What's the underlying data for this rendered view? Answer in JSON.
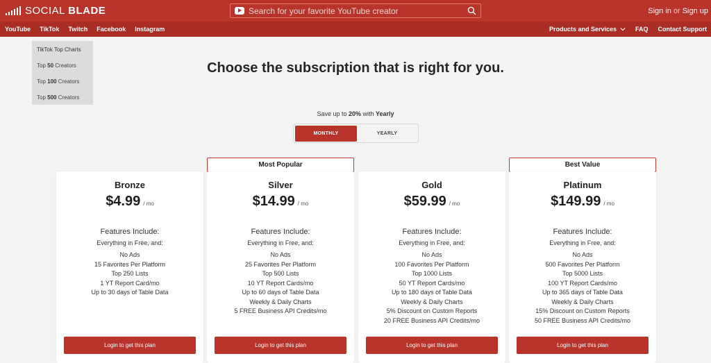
{
  "brand": {
    "name_light": "SOCIAL ",
    "name_bold": "BLADE"
  },
  "search": {
    "placeholder": "Search for your favorite YouTube creator"
  },
  "auth": {
    "sign_in": "Sign in",
    "or": "or",
    "sign_up": "Sign up"
  },
  "nav": {
    "left": [
      "YouTube",
      "TikTok",
      "Twitch",
      "Facebook",
      "Instagram"
    ],
    "products": "Products and Services",
    "faq": "FAQ",
    "contact": "Contact Support"
  },
  "dropdown": {
    "title": "TikTok Top Charts",
    "items": [
      {
        "pre": "Top ",
        "num": "50",
        "post": " Creators"
      },
      {
        "pre": "Top ",
        "num": "100",
        "post": " Creators"
      },
      {
        "pre": "Top ",
        "num": "500",
        "post": " Creators"
      }
    ]
  },
  "headline": "Choose the subscription that is right for you.",
  "save_note": {
    "pre": "Save up to ",
    "pct": "20%",
    "mid": " with ",
    "period": "Yearly"
  },
  "toggle": {
    "monthly": "MONTHLY",
    "yearly": "YEARLY",
    "selected": "MONTHLY"
  },
  "ribbons": {
    "silver": "Most Popular",
    "platinum": "Best Value"
  },
  "plans": [
    {
      "name": "Bronze",
      "price": "$4.99",
      "per": "/ mo",
      "features_head": "Features Include:",
      "features_sub": "Everything in Free, and:",
      "features": [
        "No Ads",
        "15 Favorites Per Platform",
        "Top 250 Lists",
        "1 YT Report Card/mo",
        "Up to 30 days of Table Data"
      ],
      "cta": "Login to get this plan"
    },
    {
      "name": "Silver",
      "price": "$14.99",
      "per": "/ mo",
      "features_head": "Features Include:",
      "features_sub": "Everything in Free, and:",
      "features": [
        "No Ads",
        "25 Favorites Per Platform",
        "Top 500 Lists",
        "10 YT Report Cards/mo",
        "Up to 60 days of Table Data",
        "Weekly & Daily Charts",
        "5 FREE Business API Credits/mo"
      ],
      "cta": "Login to get this plan"
    },
    {
      "name": "Gold",
      "price": "$59.99",
      "per": "/ mo",
      "features_head": "Features Include:",
      "features_sub": "Everything in Free, and:",
      "features": [
        "No Ads",
        "100 Favorites Per Platform",
        "Top 1000 Lists",
        "50 YT Report Cards/mo",
        "Up to 180 days of Table Data",
        "Weekly & Daily Charts",
        "5% Discount on Custom Reports",
        "20 FREE Business API Credits/mo"
      ],
      "cta": "Login to get this plan"
    },
    {
      "name": "Platinum",
      "price": "$149.99",
      "per": "/ mo",
      "features_head": "Features Include:",
      "features_sub": "Everything in Free, and:",
      "features": [
        "No Ads",
        "500 Favorites Per Platform",
        "Top 5000 Lists",
        "100 YT Report Cards/mo",
        "Up to 365 days of Table Data",
        "Weekly & Daily Charts",
        "15% Discount on Custom Reports",
        "50 FREE Business API Credits/mo"
      ],
      "cta": "Login to get this plan"
    }
  ],
  "colors": {
    "brand_red": "#b8332a",
    "nav_red": "#a92d24",
    "page_bg": "#f4f4f4"
  },
  "icons": {
    "search": "magnifier-icon",
    "youtube": "youtube-play-icon",
    "logo": "signal-bars-icon",
    "chevron": "chevron-down-icon"
  }
}
